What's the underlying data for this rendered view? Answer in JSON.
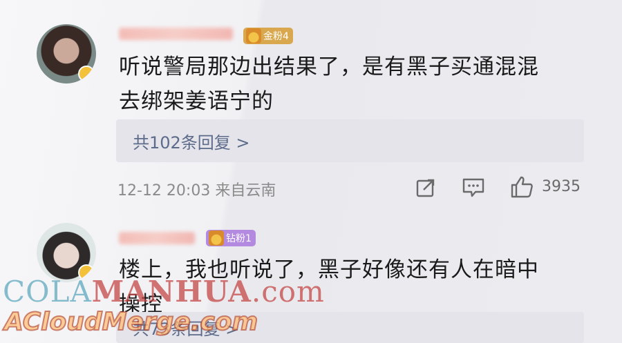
{
  "comments": [
    {
      "fan_badge": "金粉4",
      "text_line1": "听说警局那边出结果了，是有黑子买通混混",
      "text_line2": "去绑架姜语宁的",
      "replies": "共102条回复 >",
      "time_location": "12-12 20:03  来自云南",
      "likes": "3935"
    },
    {
      "fan_badge": "钻粉1",
      "text_line1": "楼上，我也听说了，黑子好像还有人在暗中",
      "text_line2": "操控",
      "replies": "共73条回复 >"
    }
  ],
  "watermark": {
    "line1_a": "COLA",
    "line1_b": "MANHUA",
    "line1_c": ".com",
    "line2": "ACloudMerge.com"
  },
  "colors": {
    "link": "#5c6b8a",
    "gold_badge": "#d9a84e",
    "diamond_badge": "#b38ae0"
  }
}
